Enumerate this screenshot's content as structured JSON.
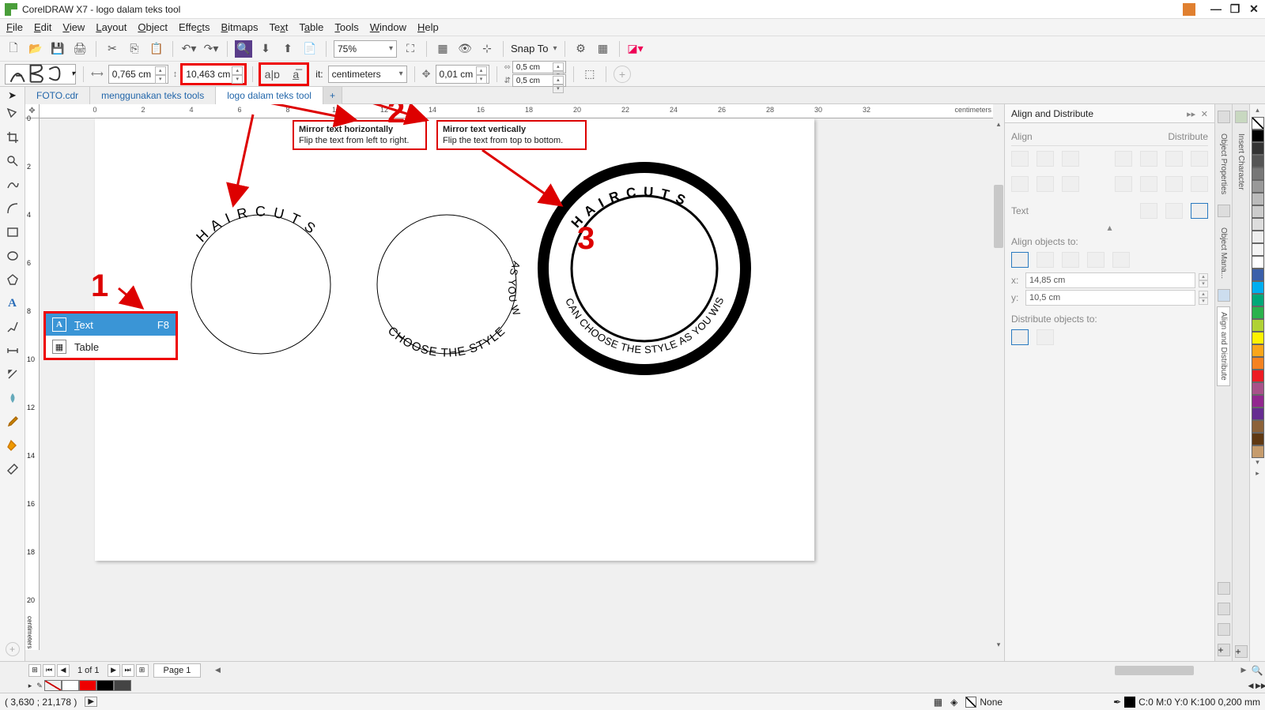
{
  "app": {
    "title": "CorelDRAW X7 - logo dalam teks tool"
  },
  "menu": {
    "file": "File",
    "edit": "Edit",
    "view": "View",
    "layout": "Layout",
    "object": "Object",
    "effects": "Effects",
    "bitmaps": "Bitmaps",
    "text": "Text",
    "table": "Table",
    "tools": "Tools",
    "window": "Window",
    "help": "Help"
  },
  "toolbar": {
    "zoom": "75%",
    "snap": "Snap To"
  },
  "propbar": {
    "shape_preview": "A B C",
    "x": "0,765 cm",
    "w": "10,463 cm",
    "units": "centimeters",
    "nudge": "0,01 cm",
    "dup_x": "0,5 cm",
    "dup_y": "0,5 cm"
  },
  "tabs": {
    "tab1": "FOTO.cdr",
    "tab2": "menggunakan teks tools",
    "tab3": "logo dalam teks tool"
  },
  "ruler": {
    "h_unit": "centimeters",
    "v_unit": "centimeters"
  },
  "tooltips": {
    "mh_title": "Mirror text horizontally",
    "mh_desc": "Flip the text from left to right.",
    "mv_title": "Mirror text vertically",
    "mv_desc": "Flip the text from top to bottom."
  },
  "flyout": {
    "text": "Text",
    "text_key": "F8",
    "table": "Table"
  },
  "annotations": {
    "n1": "1",
    "n2": "2",
    "n3": "3"
  },
  "docker": {
    "title": "Align and Distribute",
    "align": "Align",
    "distribute": "Distribute",
    "text": "Text",
    "align_to": "Align objects to:",
    "x_lbl": "x:",
    "x_val": "14,85 cm",
    "y_lbl": "y:",
    "y_val": "10,5 cm",
    "dist_to": "Distribute objects to:"
  },
  "docker_strips": {
    "obj_props": "Object Properties",
    "obj_mana": "Object Mana...",
    "align": "Align and Distribute",
    "ins_char": "Insert Character"
  },
  "pagebar": {
    "pages": "1 of 1",
    "page_tab": "Page 1"
  },
  "status": {
    "coords": "( 3,630 ; 21,178 )",
    "fill_none": "None",
    "outline": "C:0 M:0 Y:0 K:100  0,200 mm"
  },
  "canvas": {
    "hair_cuts": "H A I R   C U T S",
    "bottom_text": "CAN CHOOSE THE STYLE AS YOU WISH"
  }
}
